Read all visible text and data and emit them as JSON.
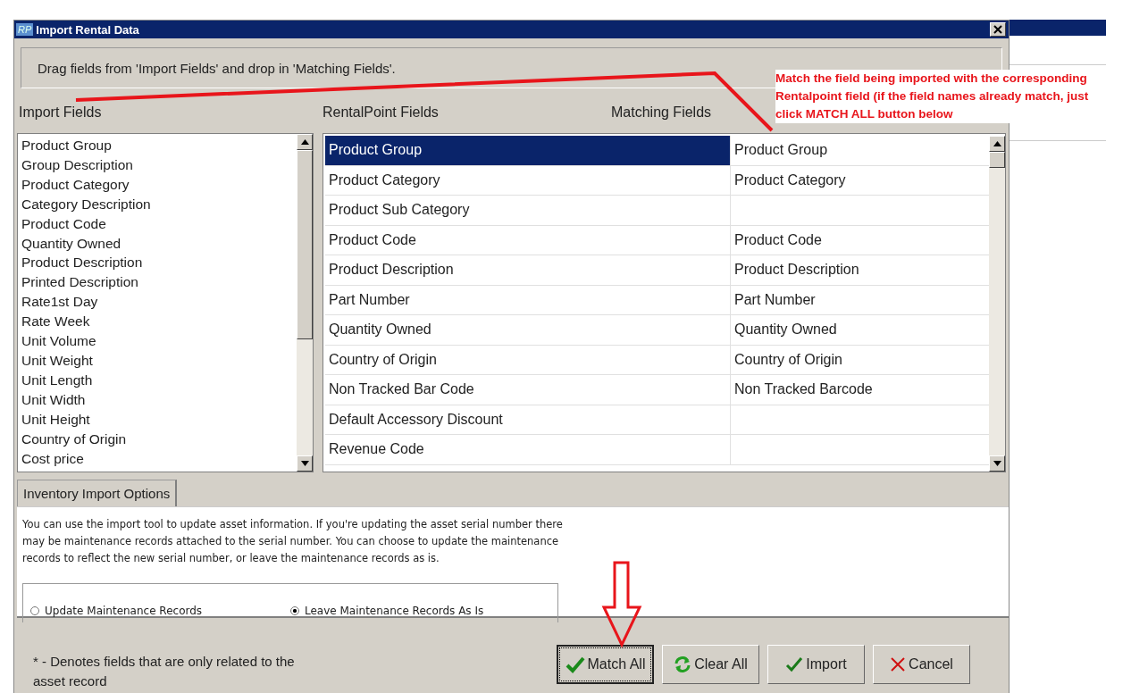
{
  "window": {
    "icon_text": "RP",
    "title": "Import Rental Data"
  },
  "hint": "Drag fields from 'Import Fields' and drop in 'Matching Fields'.",
  "headers": {
    "import": "Import Fields",
    "rentalpoint": "RentalPoint Fields",
    "matching": "Matching Fields"
  },
  "import_fields": [
    "Product Group",
    "Group Description",
    "Product Category",
    "Category Description",
    "Product Code",
    "Quantity Owned",
    "Product Description",
    "Printed Description",
    "Rate1st Day",
    "Rate Week",
    "Unit Volume",
    "Unit Weight",
    "Unit Length",
    "Unit Width",
    "Unit Height",
    "Country of Origin",
    "Cost price"
  ],
  "rows": [
    {
      "field": "Product Group",
      "match": "Product Group",
      "selected": true
    },
    {
      "field": "Product Category",
      "match": "Product Category",
      "selected": false
    },
    {
      "field": "Product Sub Category",
      "match": "",
      "selected": false
    },
    {
      "field": "Product Code",
      "match": "Product Code",
      "selected": false
    },
    {
      "field": "Product Description",
      "match": "Product Description",
      "selected": false
    },
    {
      "field": "Part Number",
      "match": "Part Number",
      "selected": false
    },
    {
      "field": "Quantity Owned",
      "match": "Quantity Owned",
      "selected": false
    },
    {
      "field": "Country of Origin",
      "match": "Country of Origin",
      "selected": false
    },
    {
      "field": "Non Tracked Bar Code",
      "match": "Non Tracked Barcode",
      "selected": false
    },
    {
      "field": "Default Accessory Discount",
      "match": "",
      "selected": false
    },
    {
      "field": "Revenue Code",
      "match": "",
      "selected": false
    }
  ],
  "tabs": [
    {
      "label": "Inventory Import Options",
      "selected": true
    }
  ],
  "options_text": "You can use the import tool to update asset information. If you're updating the asset serial number there may be maintenance records attached to the serial number. You can choose to update the maintenance records to reflect the new serial number, or leave the maintenance records as is.",
  "radios": [
    {
      "label": "Update Maintenance Records",
      "selected": false
    },
    {
      "label": "Leave Maintenance Records As Is",
      "selected": true
    }
  ],
  "footnote": "* - Denotes fields that are only related to the asset record",
  "buttons": [
    {
      "kind": "match",
      "label": "Match All",
      "focused": true
    },
    {
      "kind": "clear",
      "label": "Clear All",
      "focused": false
    },
    {
      "kind": "import",
      "label": "Import",
      "focused": false
    },
    {
      "kind": "cancel",
      "label": "Cancel",
      "focused": false
    }
  ],
  "annotation": "Match the field being imported with the corresponding Rentalpoint field (if the field names already match, just click MATCH ALL button below"
}
